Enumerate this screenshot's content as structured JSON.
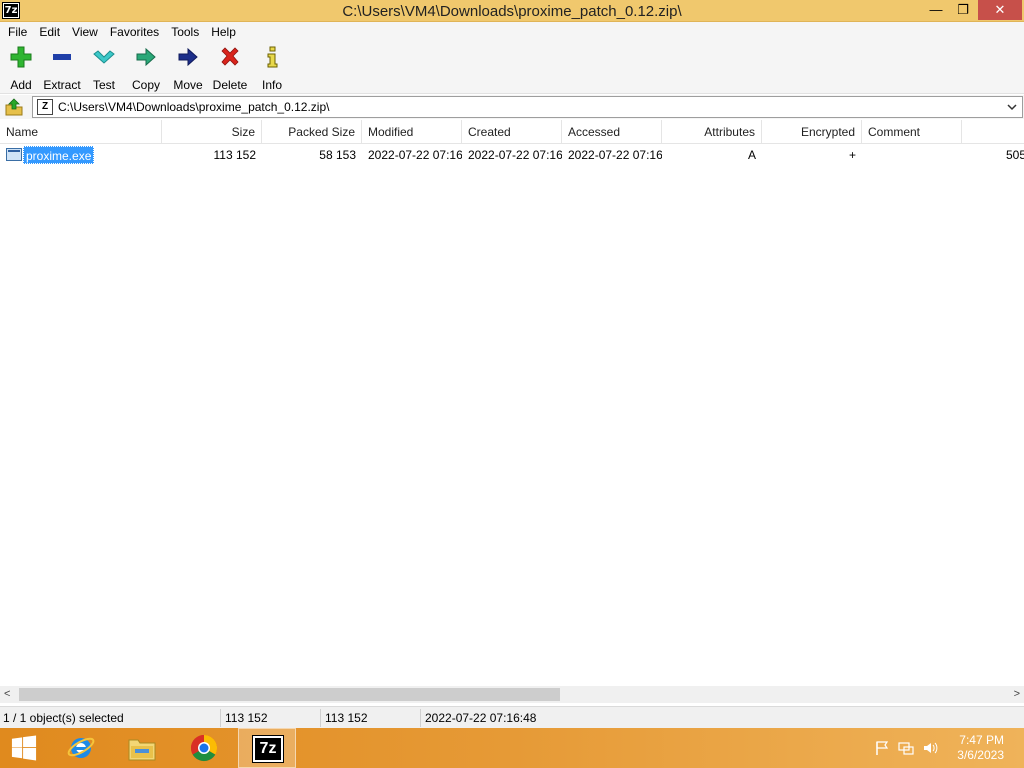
{
  "window": {
    "title": "C:\\Users\\VM4\\Downloads\\proxime_patch_0.12.zip\\",
    "app_icon_text": "7z",
    "buttons": {
      "minimize": "—",
      "maximize": "❐",
      "close": "✕"
    }
  },
  "menu": [
    "File",
    "Edit",
    "View",
    "Favorites",
    "Tools",
    "Help"
  ],
  "toolbar": [
    {
      "label": "Add",
      "icon": "add-icon"
    },
    {
      "label": "Extract",
      "icon": "extract-icon"
    },
    {
      "label": "Test",
      "icon": "test-icon"
    },
    {
      "label": "Copy",
      "icon": "copy-icon"
    },
    {
      "label": "Move",
      "icon": "move-icon"
    },
    {
      "label": "Delete",
      "icon": "delete-icon"
    },
    {
      "label": "Info",
      "icon": "info-icon"
    }
  ],
  "address": {
    "path": "C:\\Users\\VM4\\Downloads\\proxime_patch_0.12.zip\\",
    "zip_icon_text": "Z"
  },
  "columns": [
    "Name",
    "Size",
    "Packed Size",
    "Modified",
    "Created",
    "Accessed",
    "Attributes",
    "Encrypted",
    "Comment",
    ""
  ],
  "rows": [
    {
      "name": "proxime.exe",
      "size": "113 152",
      "packed_size": "58 153",
      "modified": "2022-07-22 07:16",
      "created": "2022-07-22 07:16",
      "accessed": "2022-07-22 07:16",
      "attributes": "A",
      "encrypted": "+",
      "comment": "",
      "extra": "505"
    }
  ],
  "status": {
    "selection": "1 / 1 object(s) selected",
    "size": "113 152",
    "packed": "113 152",
    "date": "2022-07-22 07:16:48"
  },
  "scrollbar": {
    "left_arrow": "<",
    "right_arrow": ">"
  },
  "taskbar": {
    "sevenzip_text": "7z",
    "time": "7:47 PM",
    "date": "3/6/2023"
  },
  "colors": {
    "titlebar": "#f0c86d",
    "selection": "#3399ff",
    "taskbar": "#e69a36"
  }
}
